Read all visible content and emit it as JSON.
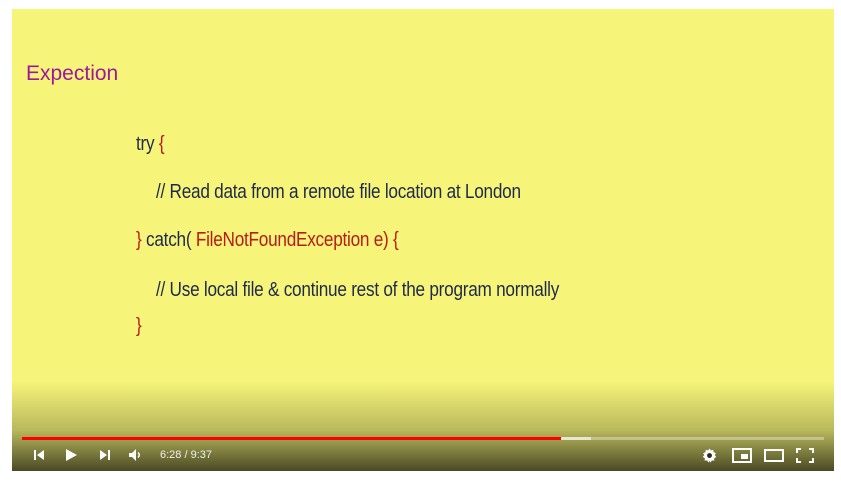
{
  "slide": {
    "title": "Expection",
    "code": {
      "try_kw": "try",
      "open_brace": "{",
      "comment1": "//  Read data from a remote file location at London",
      "close_brace": "}",
      "catch_kw": "catch(",
      "exception_type": " FileNotFoundException",
      "exception_var": " e)",
      "catch_open": "{",
      "comment2": "//  Use local file & continue rest of the program normally",
      "final_brace": "}"
    }
  },
  "player": {
    "time_display": "6:28 / 9:37",
    "progress_fraction": 0.6716,
    "buffered_fraction": 0.71,
    "colors": {
      "played": "#ff0000",
      "slide_bg": "#f6f57a",
      "title": "#a0179e",
      "code": "#1f2a4a",
      "accent": "#b71c1c"
    },
    "icons": [
      "previous-icon",
      "play-icon",
      "next-icon",
      "volume-icon",
      "settings-icon",
      "miniplayer-icon",
      "theater-mode-icon",
      "fullscreen-icon"
    ]
  }
}
